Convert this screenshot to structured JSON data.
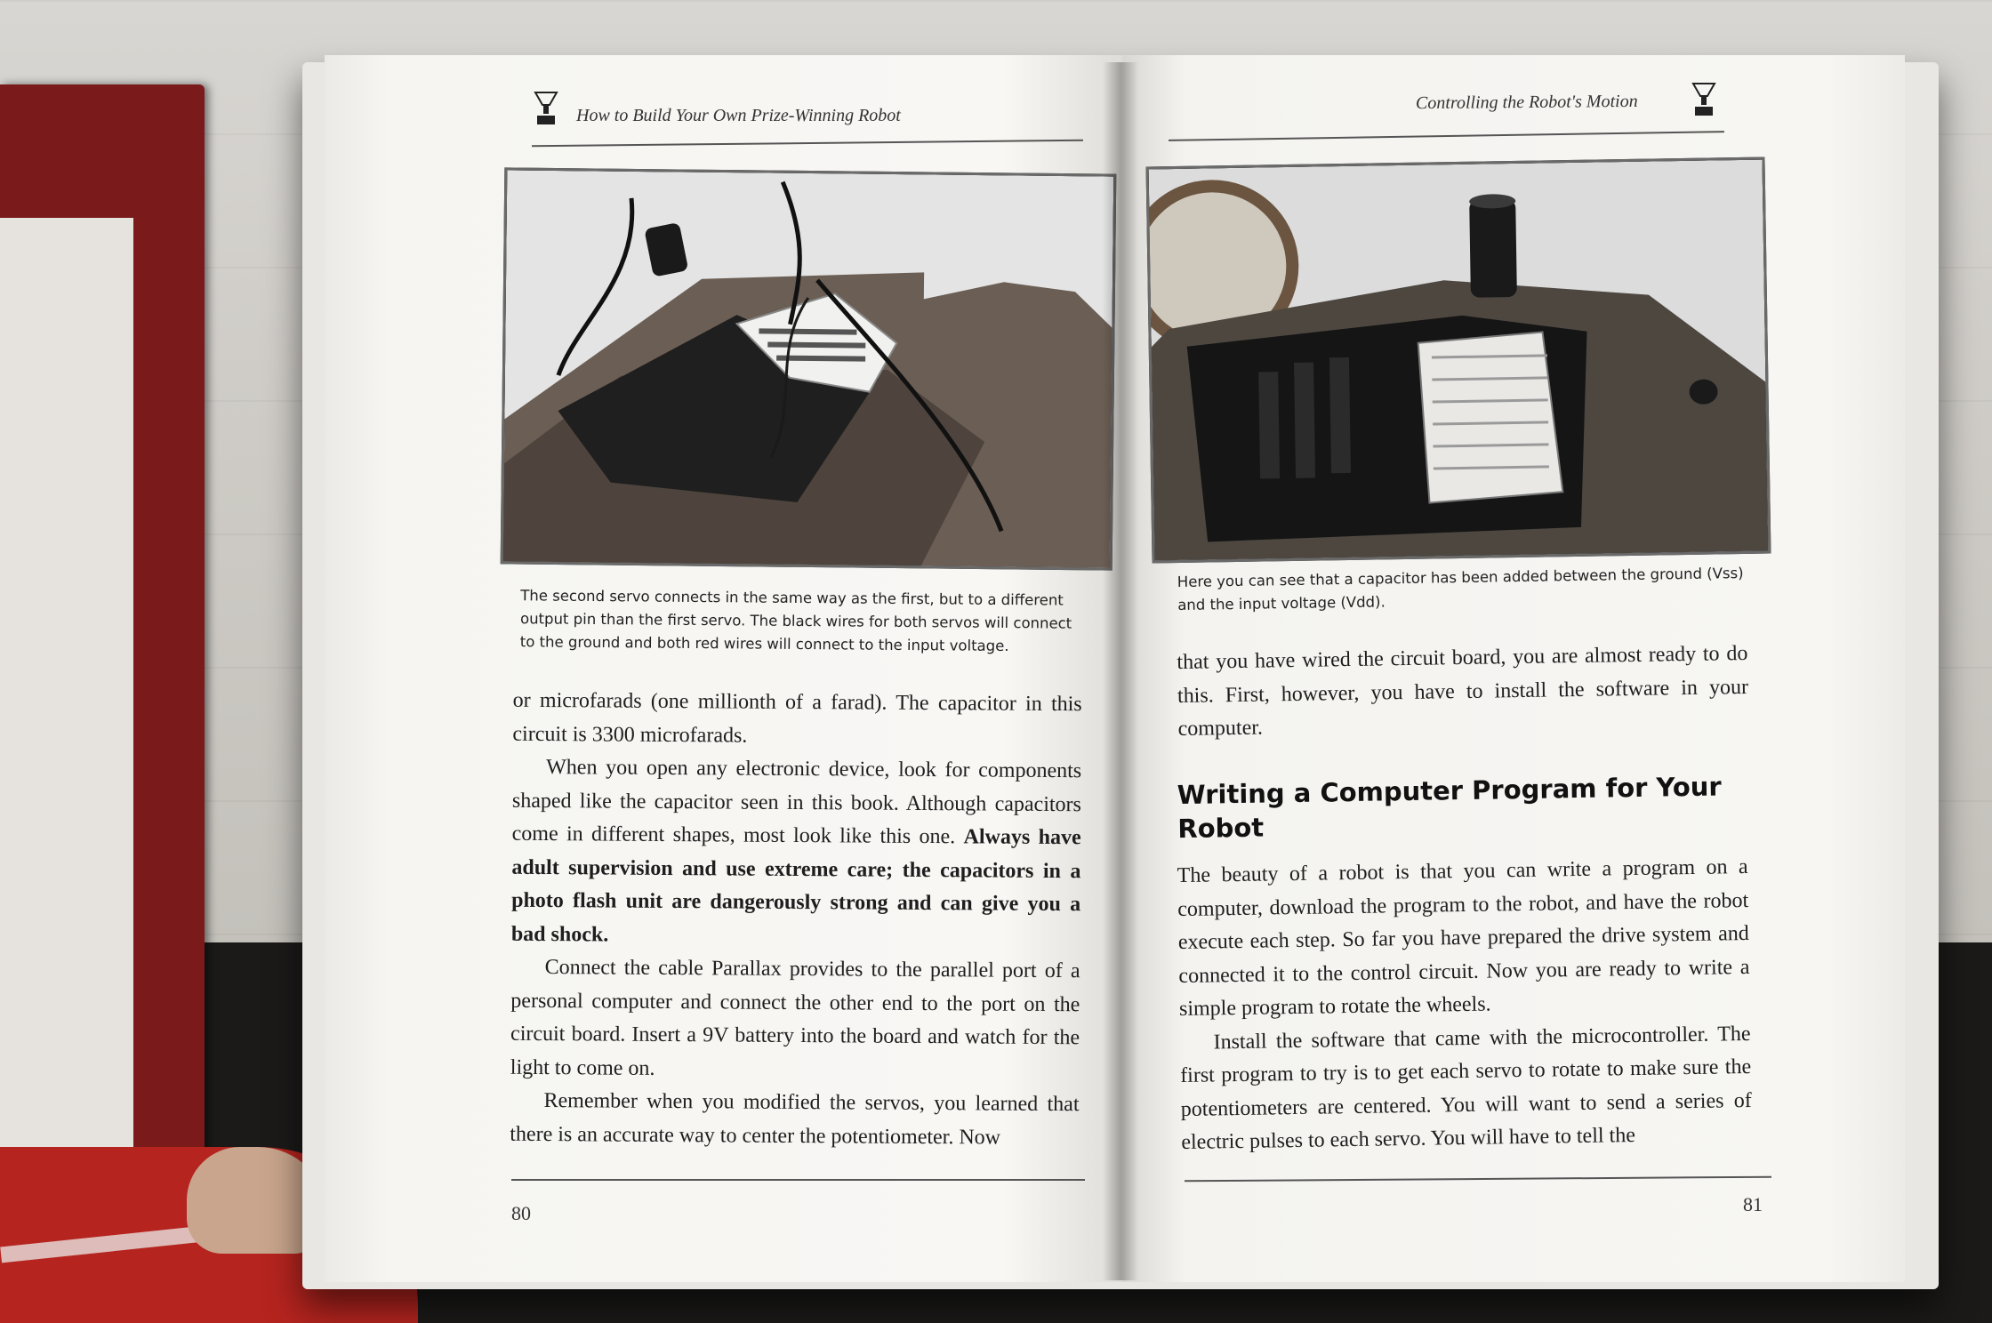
{
  "left_page": {
    "running_head": "How to Build Your Own Prize-Winning Robot",
    "photo_alt": "Breadboard and controller board with servos and capacitor",
    "caption": "The second servo connects in the same way as the first, but to a different output pin than the first servo. The black wires for both servos will connect to the ground and both red wires will connect to the input voltage.",
    "paragraphs": [
      {
        "indent": false,
        "text": "or microfarads (one millionth of a farad). The capacitor in this circuit is 3300 microfarads."
      },
      {
        "indent": true,
        "text": "When you open any electronic device, look for components shaped like the capacitor seen in this book. Although capacitors come in different shapes, most look like this one. ",
        "bold": "Always have adult supervision and use extreme care; the capacitors in a photo flash unit are dangerously strong and can give you a bad shock."
      },
      {
        "indent": true,
        "text": "Connect the cable Parallax provides to the parallel port of a personal computer and connect the other end to the port on the circuit board. Insert a 9V battery into the board and watch for the light to come on."
      },
      {
        "indent": true,
        "text": "Remember when you modified the servos, you learned that there is an accurate way to center the potentiometer. Now"
      }
    ],
    "page_number": "80"
  },
  "right_page": {
    "running_head": "Controlling the Robot's Motion",
    "photo_alt": "Board of Education with capacitor added",
    "caption": "Here you can see that a capacitor has been added between the ground (Vss) and the input voltage (Vdd).",
    "intro_paragraph": "that you have wired the circuit board, you are almost ready to do this. First, however, you have to install the software in your computer.",
    "section_heading": "Writing a Computer Program for Your Robot",
    "paragraphs": [
      {
        "indent": false,
        "text": "The beauty of a robot is that you can write a program on a computer, download the program to the robot, and have the robot execute each step. So far you have prepared the drive system and connected it to the control circuit. Now you are ready to write a simple program to rotate the wheels."
      },
      {
        "indent": true,
        "text": "Install the software that came with the microcontroller. The first program to try is to get each servo to rotate to make sure the potentiometers are centered. You will want to send a series of electric pulses to each servo. You will have to tell the"
      }
    ],
    "page_number": "81"
  },
  "colors": {
    "paper": "#f5f4f1",
    "ink": "#1e1e1e",
    "wall": "#d2cfca",
    "desk": "#1b1a19",
    "sweater_red": "#b5241f"
  }
}
